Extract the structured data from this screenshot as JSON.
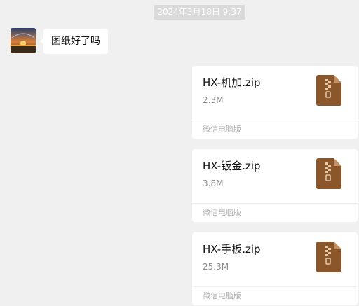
{
  "timestamp": "2024年3月18日 9:37",
  "message": {
    "text": "图纸好了吗"
  },
  "files": [
    {
      "name": "HX-机加.zip",
      "size": "2.3M",
      "source": "微信电脑版",
      "icon": "zip-file-icon"
    },
    {
      "name": "HX-钣金.zip",
      "size": "3.8M",
      "source": "微信电脑版",
      "icon": "zip-file-icon"
    },
    {
      "name": "HX-手板.zip",
      "size": "25.3M",
      "source": "微信电脑版",
      "icon": "zip-file-icon"
    }
  ],
  "colors": {
    "background": "#f0f0f0",
    "bubble": "#ffffff",
    "zip_icon": "#8b572a"
  }
}
